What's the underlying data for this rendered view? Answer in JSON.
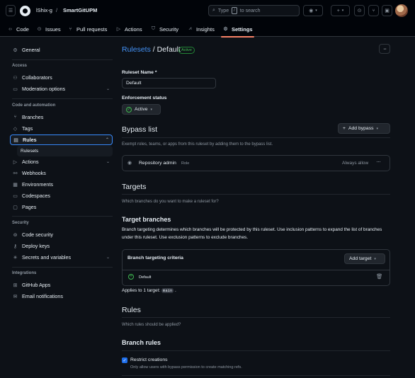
{
  "header": {
    "owner": "lShix-g",
    "separator": "/",
    "repo": "SmartGitUPM",
    "search_placeholder": "Type",
    "search_key": "/",
    "search_suffix": "to search",
    "tabs": [
      {
        "label": "Code",
        "icon": "code-icon"
      },
      {
        "label": "Issues",
        "icon": "issue-icon"
      },
      {
        "label": "Pull requests",
        "icon": "pull-request-icon"
      },
      {
        "label": "Actions",
        "icon": "play-icon"
      },
      {
        "label": "Security",
        "icon": "shield-icon"
      },
      {
        "label": "Insights",
        "icon": "graph-icon"
      },
      {
        "label": "Settings",
        "icon": "gear-icon",
        "active": true
      }
    ]
  },
  "sidebar": {
    "general": "General",
    "access_heading": "Access",
    "collaborators": "Collaborators",
    "moderation": "Moderation options",
    "code_heading": "Code and automation",
    "branches": "Branches",
    "tags": "Tags",
    "rules": "Rules",
    "rulesets": "Rulesets",
    "actions": "Actions",
    "webhooks": "Webhooks",
    "environments": "Environments",
    "codespaces": "Codespaces",
    "pages": "Pages",
    "security_heading": "Security",
    "code_security": "Code security",
    "deploy_keys": "Deploy keys",
    "secrets": "Secrets and variables",
    "integrations_heading": "Integrations",
    "github_apps": "GitHub Apps",
    "email_notifications": "Email notifications"
  },
  "main": {
    "breadcrumb_link": "Rulesets",
    "breadcrumb_sep": "/",
    "breadcrumb_current": "Default",
    "status_badge": "Active",
    "name_label": "Ruleset Name *",
    "name_value": "Default",
    "enforcement_label": "Enforcement status",
    "enforcement_value": "Active",
    "bypass_title": "Bypass list",
    "add_bypass": "Add bypass",
    "bypass_desc": "Exempt roles, teams, or apps from this ruleset by adding them to the bypass list.",
    "bypass_actor": "Repository admin",
    "bypass_actor_type": "Role",
    "bypass_mode": "Always allow",
    "targets_title": "Targets",
    "targets_desc": "Which branches do you want to make a ruleset for?",
    "target_branches_title": "Target branches",
    "target_branches_desc": "Branch targeting determines which branches will be protected by this ruleset. Use inclusion patterns to expand the list of branches under this ruleset. Use exclusion patterns to exclude branches.",
    "criteria_title": "Branch targeting criteria",
    "add_target": "Add target",
    "criteria_item": "Default",
    "applies_prefix": "Applies to 1 target:",
    "applies_target": "main",
    "applies_suffix": ".",
    "rules_title": "Rules",
    "rules_desc": "Which rules should be applied?",
    "branch_rules_title": "Branch rules",
    "restrict_label": "Restrict creations",
    "restrict_desc": "Only allow users with bypass permission to create matching refs."
  }
}
